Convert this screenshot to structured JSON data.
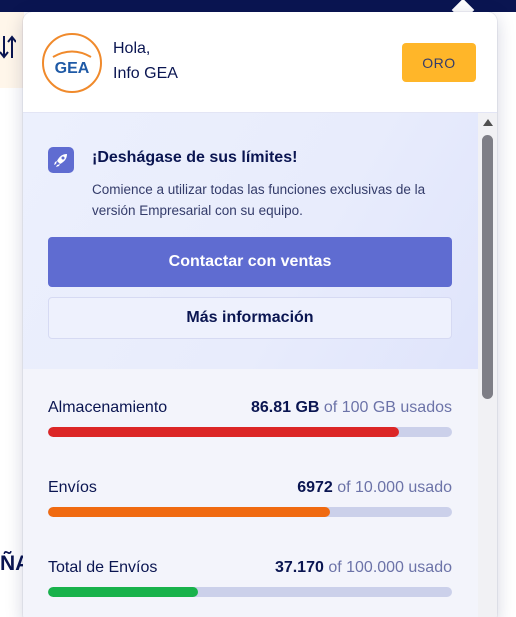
{
  "background": {
    "partial_text": "ÑA"
  },
  "header": {
    "greeting": "Hola,",
    "user_name": "Info GEA",
    "avatar_text": "GEA",
    "plan_badge": "ORO"
  },
  "promo": {
    "title": "¡Deshágase de sus límites!",
    "description": "Comience a utilizar todas las funciones exclusivas de la versión Empresarial con su equipo.",
    "primary_button": "Contactar con ventas",
    "secondary_button": "Más información"
  },
  "usage": [
    {
      "label": "Almacenamiento",
      "used": "86.81 GB",
      "limit_text": "of 100 GB usados",
      "fraction": 0.8681,
      "color": "#dc2626"
    },
    {
      "label": "Envíos",
      "used": "6972",
      "limit_text": "of 10.000 usado",
      "fraction": 0.6972,
      "color": "#f06a10"
    },
    {
      "label": "Total de Envíos",
      "used": "37.170",
      "limit_text": "of 100.000 usado",
      "fraction": 0.3717,
      "color": "#18b24b"
    }
  ],
  "colors": {
    "accent": "#5f6cd1",
    "badge": "#ffb629",
    "avatar_ring": "#f08a2c"
  }
}
